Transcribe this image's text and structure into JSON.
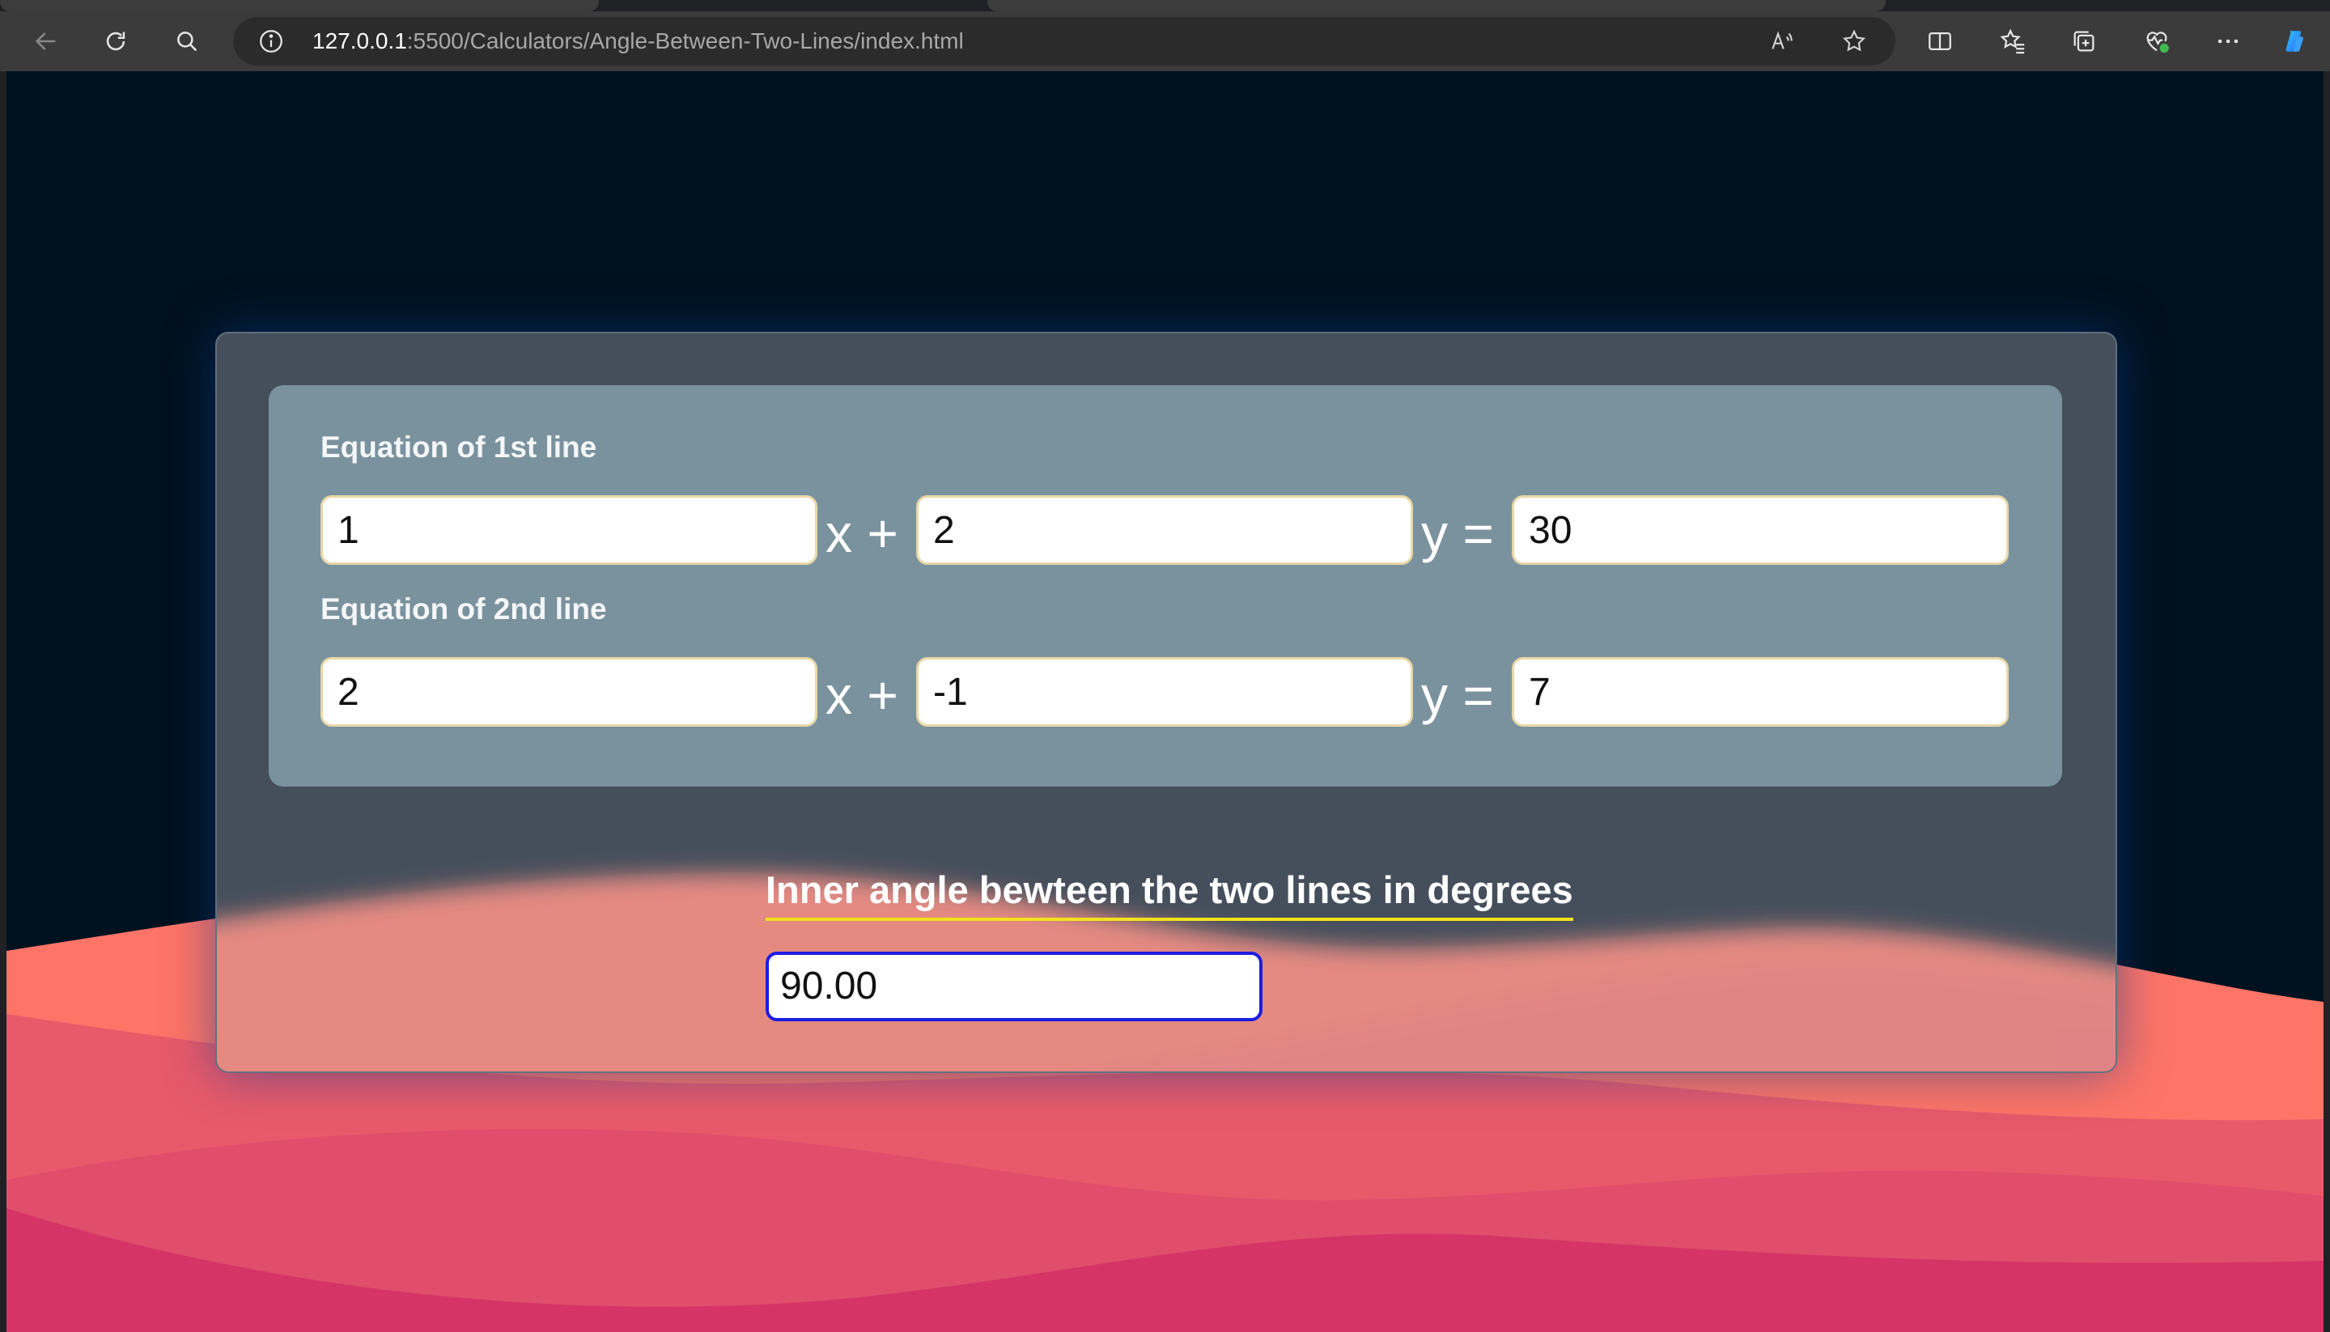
{
  "browser": {
    "url_host": "127.0.0.1",
    "url_rest": ":5500/Calculators/Angle-Between-Two-Lines/index.html",
    "icons": [
      "back-arrow-icon",
      "refresh-icon",
      "search-icon",
      "info-icon",
      "read-aloud-icon",
      "favorite-star-icon",
      "split-screen-icon",
      "favorites-icon",
      "collections-icon",
      "browser-essentials-icon",
      "more-options-icon",
      "copilot-icon"
    ]
  },
  "calculator": {
    "line1": {
      "label": "Equation of 1st line",
      "a": "1",
      "b": "2",
      "c": "30"
    },
    "line2": {
      "label": "Equation of 2nd line",
      "a": "2",
      "b": "-1",
      "c": "7"
    },
    "ops": {
      "x_plus": "x +",
      "y_equals": "y ="
    },
    "result": {
      "title": "Inner angle bewteen the two lines in degrees",
      "value": "90.00"
    }
  },
  "colors": {
    "page_background": "#00111f",
    "card": "#47525e",
    "inner_panel": "#7a929e",
    "title_underline": "#f2e21c",
    "result_border": "#1d1de0",
    "wave_light": "#ff8a7a",
    "wave_mid": "#e85a6a",
    "wave_dark": "#d63466"
  }
}
